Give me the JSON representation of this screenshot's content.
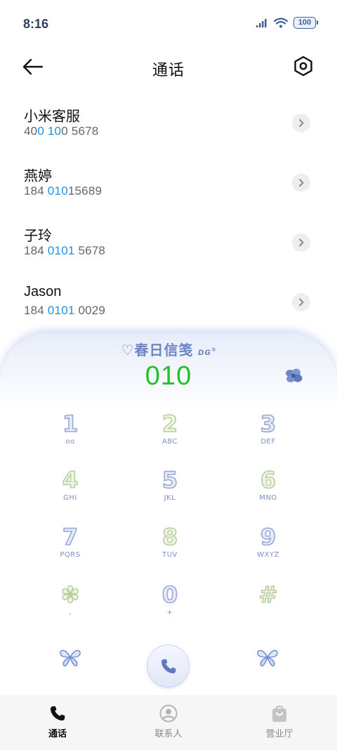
{
  "status_bar": {
    "time": "8:16",
    "battery": "100"
  },
  "header": {
    "title": "通话"
  },
  "contacts": [
    {
      "name": "小米客服",
      "number_parts": [
        "40",
        "0",
        " ",
        "10",
        "0 5678"
      ]
    },
    {
      "name": "燕婷",
      "number_parts": [
        "184 ",
        "010",
        "",
        "",
        "15689"
      ]
    },
    {
      "name": "子玲",
      "number_parts": [
        "184 ",
        "0101",
        "",
        "",
        " 5678"
      ]
    },
    {
      "name": "Jason",
      "number_parts": [
        "184 ",
        "0101",
        "",
        "",
        " 0029"
      ]
    }
  ],
  "dialer": {
    "brand": "♡春日信笺",
    "brand_tag": "ᴅɢ°",
    "dialed_number": "010",
    "keys": [
      {
        "digit": "1",
        "sub": "ᴏᴏ"
      },
      {
        "digit": "2",
        "sub": "ABC"
      },
      {
        "digit": "3",
        "sub": "DEF"
      },
      {
        "digit": "4",
        "sub": "GHI"
      },
      {
        "digit": "5",
        "sub": "JKL"
      },
      {
        "digit": "6",
        "sub": "MNO"
      },
      {
        "digit": "7",
        "sub": "PQRS"
      },
      {
        "digit": "8",
        "sub": "TUV"
      },
      {
        "digit": "9",
        "sub": "WXYZ"
      },
      {
        "digit": "✽",
        "sub": ","
      },
      {
        "digit": "0",
        "sub": "+"
      },
      {
        "digit": "#",
        "sub": ""
      }
    ]
  },
  "bottom_nav": {
    "calls": "通话",
    "contacts": "联系人",
    "store": "营业厅"
  },
  "colors": {
    "accent_blue": "#1e90e8",
    "dial_green": "#22c02e",
    "key_blue": "#9aa8d4",
    "key_green": "#b8cfa0"
  }
}
